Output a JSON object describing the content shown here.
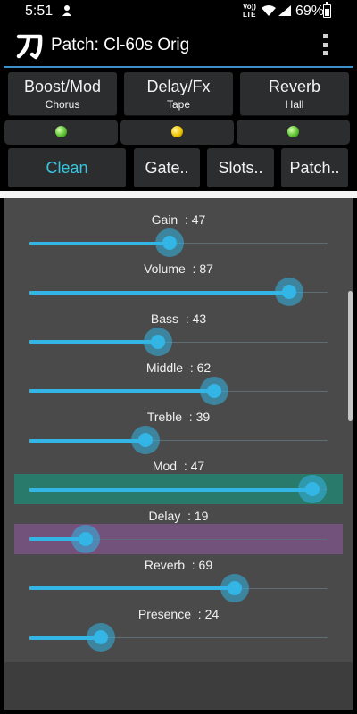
{
  "status": {
    "time": "5:51",
    "network": "Vo)) LTE",
    "battery": "69%"
  },
  "app": {
    "title": "Patch: Cl-60s Orig",
    "logo_icon": "kanji-logo-icon",
    "menu_icon": "overflow-menu-icon"
  },
  "effects": [
    {
      "label": "Boost/Mod",
      "sub": "Chorus",
      "led": "green"
    },
    {
      "label": "Delay/Fx",
      "sub": "Tape",
      "led": "yellow"
    },
    {
      "label": "Reverb",
      "sub": "Hall",
      "led": "green"
    }
  ],
  "buttons": {
    "clean": "Clean",
    "gate": "Gate..",
    "slots": "Slots..",
    "patch": "Patch.."
  },
  "sliders": [
    {
      "name": "Gain",
      "value": 47,
      "position": 0.47
    },
    {
      "name": "Volume",
      "value": 87,
      "position": 0.87
    },
    {
      "name": "Bass",
      "value": 43,
      "position": 0.43
    },
    {
      "name": "Middle",
      "value": 62,
      "position": 0.62
    },
    {
      "name": "Treble",
      "value": 39,
      "position": 0.39
    },
    {
      "name": "Mod",
      "value": 47,
      "position": 0.95,
      "highlight": "#2a7a6c"
    },
    {
      "name": "Delay",
      "value": 19,
      "position": 0.19,
      "highlight": "#72517a"
    },
    {
      "name": "Reverb",
      "value": 69,
      "position": 0.69
    },
    {
      "name": "Presence",
      "value": 24,
      "position": 0.24
    }
  ],
  "colors": {
    "accent": "#33b5e5",
    "clean_text": "#38c6df",
    "appbar_line": "#3d8fc7"
  }
}
